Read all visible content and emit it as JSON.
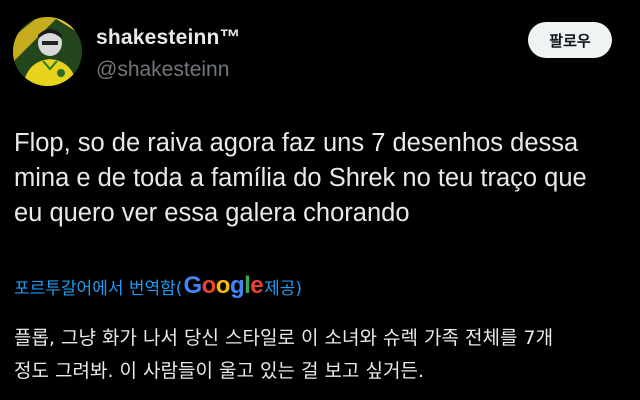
{
  "user": {
    "display_name": "shakesteinn™",
    "handle": "@shakesteinn"
  },
  "follow_button": {
    "label": "팔로우"
  },
  "tweet": {
    "lines": [
      "Flop, so de raiva agora faz uns 7 desenhos dessa",
      "mina e de toda a família do Shrek no teu traço que",
      "eu quero ver essa galera chorando"
    ]
  },
  "translation": {
    "prefix": "포르투갈어에서 번역함(",
    "provider": "Google",
    "suffix": " 제공)",
    "lines": [
      "플롭, 그냥 화가 나서 당신 스타일로 이 소녀와 슈렉 가족 전체를 7개",
      "정도 그려봐. 이 사람들이 울고 있는 걸 보고 싶거든."
    ]
  },
  "colors": {
    "background": "#000000",
    "link_blue": "#1d9bf0",
    "handle_gray": "#71767b",
    "google_blue": "#4285f4",
    "google_red": "#ea4335",
    "google_yellow": "#fbbc05",
    "google_green": "#34a853"
  }
}
